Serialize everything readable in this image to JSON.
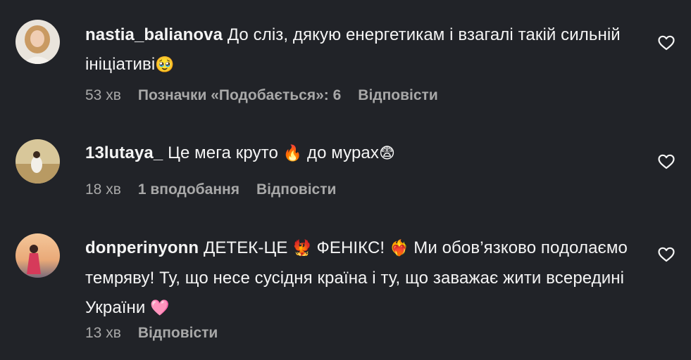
{
  "comments": [
    {
      "username": "nastia_balianova",
      "text": "До сліз, дякую енергетикам і взагалі такій сильній ініціативі",
      "emoji_after": "🥹",
      "time": "53 хв",
      "likes": "Позначки «Подобається»: 6",
      "reply": "Відповісти"
    },
    {
      "username": "13lutaya_",
      "text_parts": [
        "Це мега круто",
        "до мурах"
      ],
      "emojis": [
        "🔥",
        "😨"
      ],
      "time": "18 хв",
      "likes": "1 вподобання",
      "reply": "Відповісти"
    },
    {
      "username": "donperinyonn",
      "text_parts": [
        "ДЕТЕК-ЦЕ",
        "ФЕНІКС!",
        "Ми обов’язково подолаємо темряву! Ту, що несе сусідня країна і ту, що заважає жити всередині України"
      ],
      "emojis": [
        "🐦‍🔥",
        "❤️‍🔥",
        "🩷"
      ],
      "time": "13 хв",
      "reply": "Відповісти"
    }
  ],
  "icons": {
    "like": "heart-outline-icon"
  },
  "colors": {
    "background": "#212328",
    "text": "#f5f5f5",
    "muted": "#a8a8a8"
  }
}
